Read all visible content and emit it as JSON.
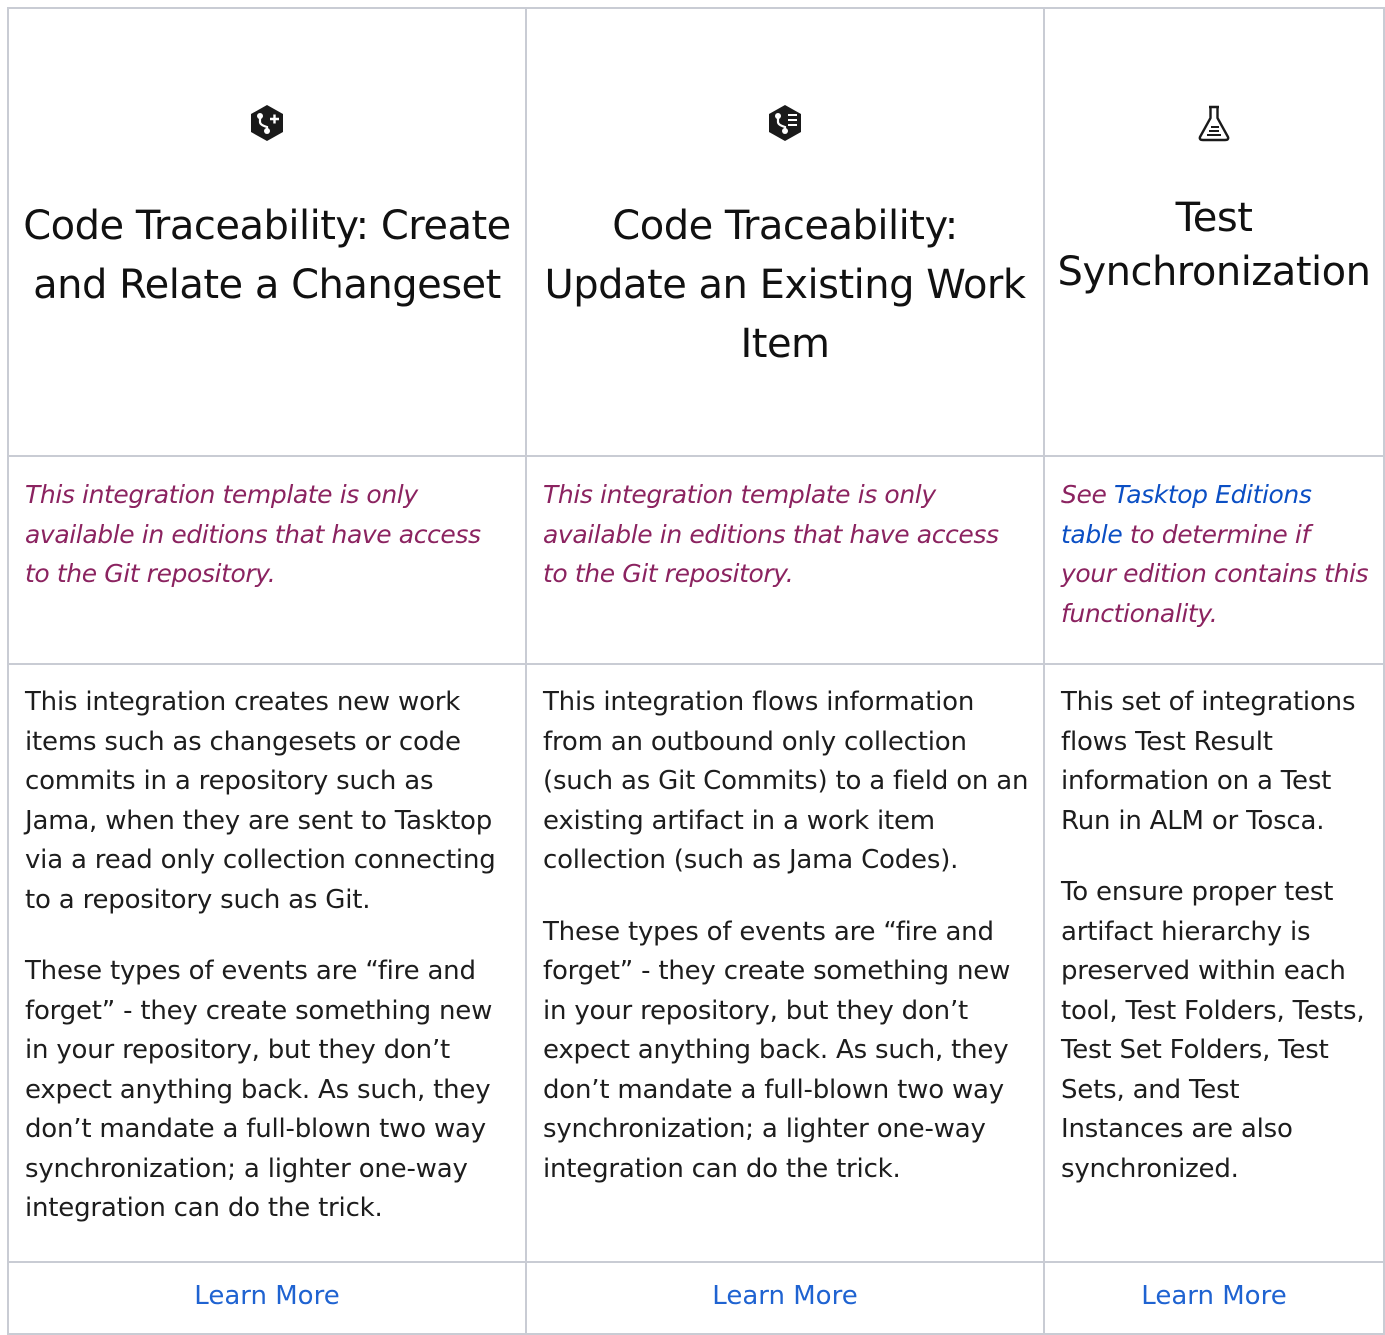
{
  "columns": [
    {
      "icon": "git-branch-plus-icon",
      "title": "Code Traceability: Create and Relate a Changeset",
      "note": "This integration template is only available in editions that have access to the Git repository.",
      "desc": [
        "This integration creates new work items such as changesets or code commits in a repository such as Jama, when they are sent to Tasktop via a read only collection connecting to a repository such as Git.",
        "These types of events are “fire and forget” - they create something new in your repository, but they don’t expect anything back. As such, they don’t mandate a full-blown two way synchronization; a lighter one-way integration can do the trick."
      ],
      "link": "Learn More"
    },
    {
      "icon": "git-branch-list-icon",
      "title": "Code Traceability: Update an Existing Work Item",
      "note": "This integration template is only available in editions that have access to the Git repository.",
      "desc": [
        "This integration flows information from an outbound only collection (such as Git Commits) to a field on an existing artifact in a work item collection (such as Jama Codes).",
        "These types of events are “fire and forget” - they create something new in your repository, but they don’t expect anything back. As such, they don’t mandate a full-blown two way synchronization; a lighter one-way integration can do the trick."
      ],
      "link": "Learn More"
    },
    {
      "icon": "flask-icon",
      "title": "Test Synchronization",
      "note_pre": "See ",
      "note_link": "Tasktop Editions table",
      "note_post": " to determine if your edition contains this functionality.",
      "desc": [
        "This set of integrations flows Test Result information on a Test Run in ALM or Tosca.",
        "To ensure proper test artifact hierarchy is preserved within each tool, Test Folders, Tests, Test Set Folders, Test Sets, and Test Instances are also synchronized."
      ],
      "link": "Learn More"
    }
  ],
  "colors": {
    "note": "#8b2360",
    "link": "#1f63d1",
    "border": "#c9ccd4"
  }
}
